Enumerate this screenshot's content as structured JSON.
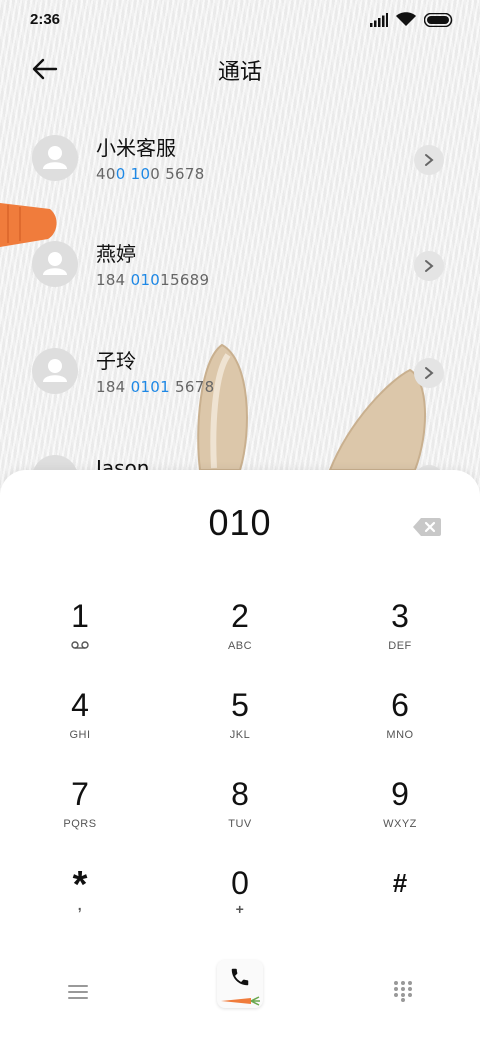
{
  "status_bar": {
    "time": "2:36"
  },
  "header": {
    "title": "通话"
  },
  "contacts": [
    {
      "name": "小米客服",
      "number_parts": [
        "40",
        "0 10",
        "0 5678"
      ]
    },
    {
      "name": "燕婷",
      "number_parts": [
        "184 ",
        "010",
        "15689"
      ]
    },
    {
      "name": "子玲",
      "number_parts": [
        "184 ",
        "0101",
        " 5678"
      ]
    },
    {
      "name": "Jason"
    }
  ],
  "dialer": {
    "input": "010",
    "keys": [
      {
        "digit": "1",
        "letters": ""
      },
      {
        "digit": "2",
        "letters": "ABC"
      },
      {
        "digit": "3",
        "letters": "DEF"
      },
      {
        "digit": "4",
        "letters": "GHI"
      },
      {
        "digit": "5",
        "letters": "JKL"
      },
      {
        "digit": "6",
        "letters": "MNO"
      },
      {
        "digit": "7",
        "letters": "PQRS"
      },
      {
        "digit": "8",
        "letters": "TUV"
      },
      {
        "digit": "9",
        "letters": "WXYZ"
      },
      {
        "digit": "*",
        "letters": ","
      },
      {
        "digit": "0",
        "letters": "+"
      },
      {
        "digit": "#",
        "letters": ""
      }
    ]
  },
  "icons": {
    "back": "arrow-left-icon",
    "chevron": "chevron-right-icon",
    "backspace": "backspace-icon",
    "voicemail": "voicemail-icon",
    "menu": "menu-icon",
    "call": "phone-icon",
    "dialpad": "dialpad-icon"
  },
  "colors": {
    "highlight": "#1e88e5",
    "accent_carrot": "#f07c3c"
  }
}
